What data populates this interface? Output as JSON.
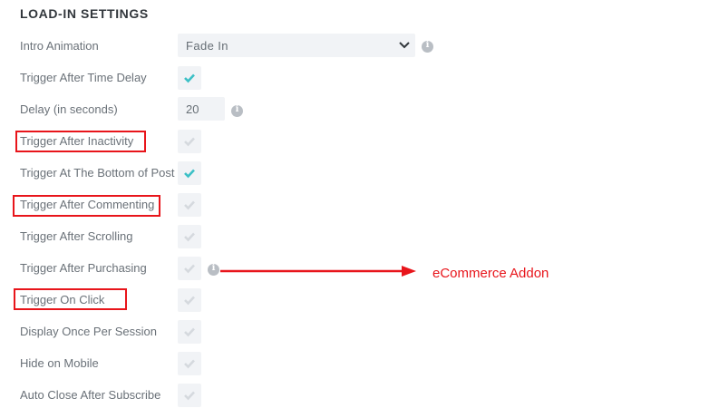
{
  "section_title": "LOAD-IN SETTINGS",
  "rows": [
    {
      "label": "Intro Animation",
      "control": "select",
      "value": "Fade In",
      "info": true
    },
    {
      "label": "Trigger After Time Delay",
      "control": "checkbox",
      "checked": true
    },
    {
      "label": "Delay (in seconds)",
      "control": "number",
      "value": "20",
      "info": true
    },
    {
      "label": "Trigger After Inactivity",
      "control": "checkbox",
      "checked": false,
      "highlighted": true
    },
    {
      "label": "Trigger At The Bottom of Post",
      "control": "checkbox",
      "checked": true
    },
    {
      "label": "Trigger After Commenting",
      "control": "checkbox",
      "checked": false,
      "highlighted": true
    },
    {
      "label": "Trigger After Scrolling",
      "control": "checkbox",
      "checked": false
    },
    {
      "label": "Trigger After Purchasing",
      "control": "checkbox",
      "checked": false,
      "info": true
    },
    {
      "label": "Trigger On Click",
      "control": "checkbox",
      "checked": false,
      "highlighted": true
    },
    {
      "label": "Display Once Per Session",
      "control": "checkbox",
      "checked": false
    },
    {
      "label": "Hide on Mobile",
      "control": "checkbox",
      "checked": false
    },
    {
      "label": "Auto Close After Subscribe",
      "control": "checkbox",
      "checked": false
    }
  ],
  "annotation": {
    "text": "eCommerce Addon",
    "color": "#e8151b"
  },
  "colors": {
    "check_on": "#3cc0c6",
    "check_off": "#d5d9de",
    "control_bg": "#f1f3f6",
    "highlight": "#e8151b"
  },
  "icons": {
    "info": "info-icon",
    "check": "checkmark-icon",
    "dropdown": "chevron-down-icon",
    "arrow": "arrow-right-icon"
  }
}
